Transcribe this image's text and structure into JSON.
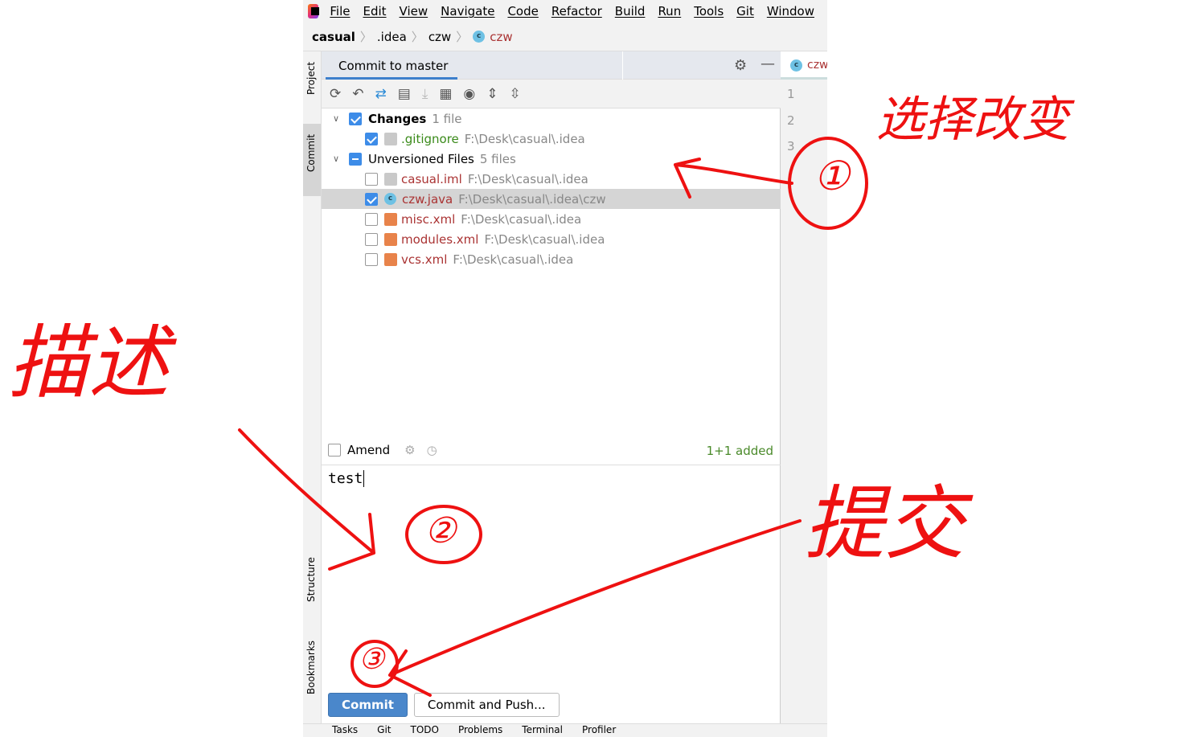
{
  "menu": [
    "File",
    "Edit",
    "View",
    "Navigate",
    "Code",
    "Refactor",
    "Build",
    "Run",
    "Tools",
    "Git",
    "Window"
  ],
  "breadcrumb": [
    "casual",
    ".idea",
    "czw",
    "czw"
  ],
  "side_tabs": [
    "Project",
    "Commit",
    "Structure",
    "Bookmarks"
  ],
  "panel": {
    "tab": "Commit to master"
  },
  "tree": [
    {
      "type": "group",
      "label": "Changes",
      "count": "1 file",
      "state": "on",
      "bold": true
    },
    {
      "type": "file",
      "name": ".gitignore",
      "path": "F:\\Desk\\casual\\.idea",
      "checked": true,
      "color": "#3a8a1a"
    },
    {
      "type": "group",
      "label": "Unversioned Files",
      "count": "5 files",
      "state": "part"
    },
    {
      "type": "file",
      "name": "casual.iml",
      "path": "F:\\Desk\\casual\\.idea",
      "checked": false,
      "color": "#a33"
    },
    {
      "type": "file",
      "name": "czw.java",
      "path": "F:\\Desk\\casual\\.idea\\czw",
      "checked": true,
      "color": "#a33",
      "selected": true
    },
    {
      "type": "file",
      "name": "misc.xml",
      "path": "F:\\Desk\\casual\\.idea",
      "checked": false,
      "color": "#a33"
    },
    {
      "type": "file",
      "name": "modules.xml",
      "path": "F:\\Desk\\casual\\.idea",
      "checked": false,
      "color": "#a33"
    },
    {
      "type": "file",
      "name": "vcs.xml",
      "path": "F:\\Desk\\casual\\.idea",
      "checked": false,
      "color": "#a33"
    }
  ],
  "amend_label": "Amend",
  "added": "1+1 added",
  "message": "test",
  "buttons": {
    "commit": "Commit",
    "commit_push": "Commit and Push..."
  },
  "editor": {
    "tab": "czw",
    "lines": [
      "1",
      "2",
      "3"
    ]
  },
  "bottom": [
    "Tasks",
    "Git",
    "TODO",
    "Problems",
    "Terminal",
    "Profiler"
  ],
  "annotations": {
    "select": "选择改变",
    "step1": "①",
    "describe": "描述",
    "step2": "②",
    "submit": "提交",
    "step3": "③"
  },
  "accent": "#3d8ce8",
  "annotation_color": "#e11"
}
